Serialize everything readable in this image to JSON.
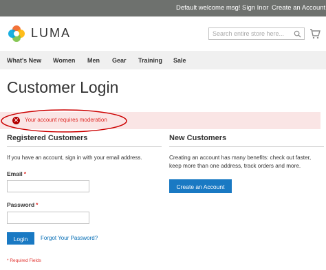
{
  "topbar": {
    "welcome": "Default welcome msg!",
    "sign_in": "Sign In",
    "or": "or",
    "create_account": "Create an Account"
  },
  "header": {
    "logo_text": "LUMA",
    "search_placeholder": "Search entire store here...",
    "search_icon": "search-icon",
    "cart_icon": "cart-icon"
  },
  "nav": {
    "items": [
      "What's New",
      "Women",
      "Men",
      "Gear",
      "Training",
      "Sale"
    ]
  },
  "page_title": "Customer Login",
  "message": {
    "text": "Your account requires moderation",
    "icon": "error-icon",
    "icon_glyph": "✕"
  },
  "registered": {
    "title": "Registered Customers",
    "intro": "If you have an account, sign in with your email address.",
    "email_label": "Email",
    "password_label": "Password",
    "required_mark": "*",
    "login_label": "Login",
    "forgot_label": "Forgot Your Password?",
    "required_note": "* Required Fields"
  },
  "new_customers": {
    "title": "New Customers",
    "description": "Creating an account has many benefits: check out faster, keep more than one address, track orders and more.",
    "create_label": "Create an Account"
  },
  "colors": {
    "topbar_bg": "#6e716e",
    "nav_bg": "#f0f0f0",
    "error_bg": "#fae5e5",
    "error_text": "#e02b27",
    "primary_button": "#1979c3",
    "link": "#006bb4",
    "annotation": "#cc0000"
  }
}
